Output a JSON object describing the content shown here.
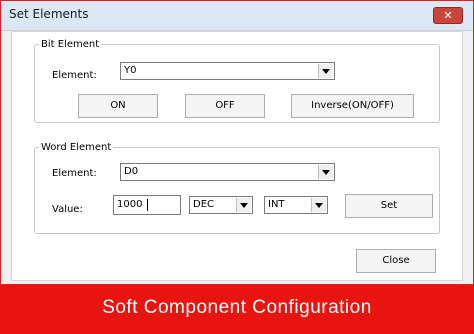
{
  "window": {
    "title": "Set Elements",
    "close_glyph": "✕"
  },
  "bit_group": {
    "legend": "Bit Element",
    "element_label": "Element:",
    "element_value": "Y0",
    "on_label": "ON",
    "off_label": "OFF",
    "inverse_label": "Inverse(ON/OFF)"
  },
  "word_group": {
    "legend": "Word Element",
    "element_label": "Element:",
    "element_value": "D0",
    "value_label": "Value:",
    "value_input": "1000",
    "format_value": "DEC",
    "type_value": "INT",
    "set_label": "Set"
  },
  "footer": {
    "close_label": "Close"
  },
  "banner": {
    "text": "Soft Component Configuration"
  },
  "colors": {
    "banner": "#e8140f",
    "titlebar": "#dbe7f5",
    "close_button": "#c9463d"
  }
}
